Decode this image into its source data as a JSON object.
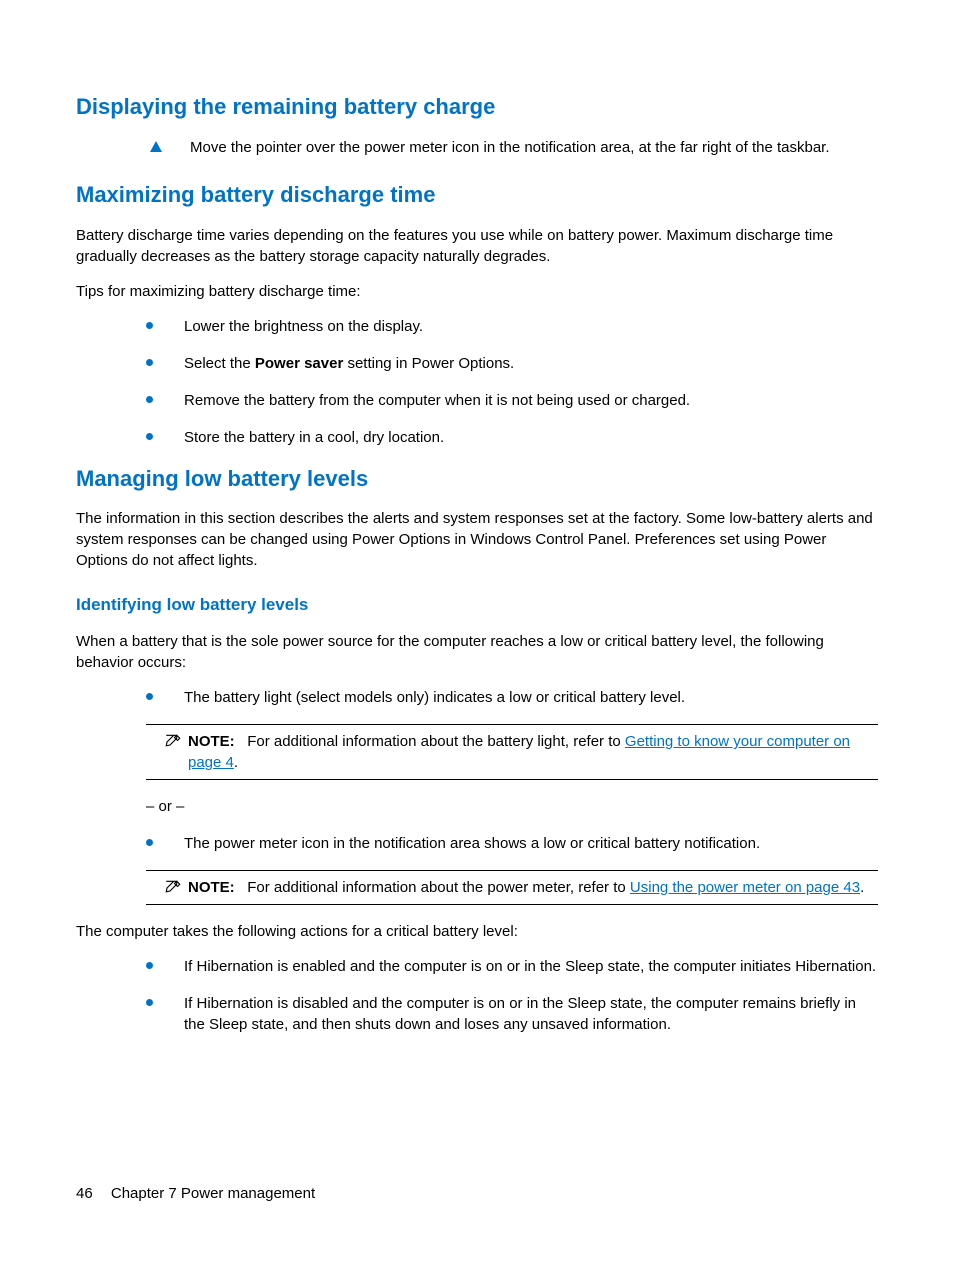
{
  "sections": {
    "displaying": {
      "heading": "Displaying the remaining battery charge",
      "triangle_text": "Move the pointer over the power meter icon in the notification area, at the far right of the taskbar."
    },
    "maximizing": {
      "heading": "Maximizing battery discharge time",
      "para1": "Battery discharge time varies depending on the features you use while on battery power. Maximum discharge time gradually decreases as the battery storage capacity naturally degrades.",
      "para2": "Tips for maximizing battery discharge time:",
      "bullets": {
        "b1": "Lower the brightness on the display.",
        "b2_pre": "Select the ",
        "b2_bold": "Power saver",
        "b2_post": " setting in Power Options.",
        "b3": "Remove the battery from the computer when it is not being used or charged.",
        "b4": "Store the battery in a cool, dry location."
      }
    },
    "managing": {
      "heading": "Managing low battery levels",
      "para1": "The information in this section describes the alerts and system responses set at the factory. Some low-battery alerts and system responses can be changed using Power Options in Windows Control Panel. Preferences set using Power Options do not affect lights."
    },
    "identifying": {
      "heading": "Identifying low battery levels",
      "para1": "When a battery that is the sole power source for the computer reaches a low or critical battery level, the following behavior occurs:",
      "bullet1": "The battery light (select models only) indicates a low or critical battery level.",
      "note1_label": "NOTE:",
      "note1_pre": "For additional information about the battery light, refer to ",
      "note1_link": "Getting to know your computer on page 4",
      "note1_post": ".",
      "or": "– or –",
      "bullet2": "The power meter icon in the notification area shows a low or critical battery notification.",
      "note2_label": "NOTE:",
      "note2_pre": "For additional information about the power meter, refer to ",
      "note2_link": "Using the power meter on page 43",
      "note2_post": ".",
      "para2": "The computer takes the following actions for a critical battery level:",
      "crit_b1": "If Hibernation is enabled and the computer is on or in the Sleep state, the computer initiates Hibernation.",
      "crit_b2": "If Hibernation is disabled and the computer is on or in the Sleep state, the computer remains briefly in the Sleep state, and then shuts down and loses any unsaved information."
    }
  },
  "footer": {
    "page_number": "46",
    "chapter": "Chapter 7   Power management"
  }
}
